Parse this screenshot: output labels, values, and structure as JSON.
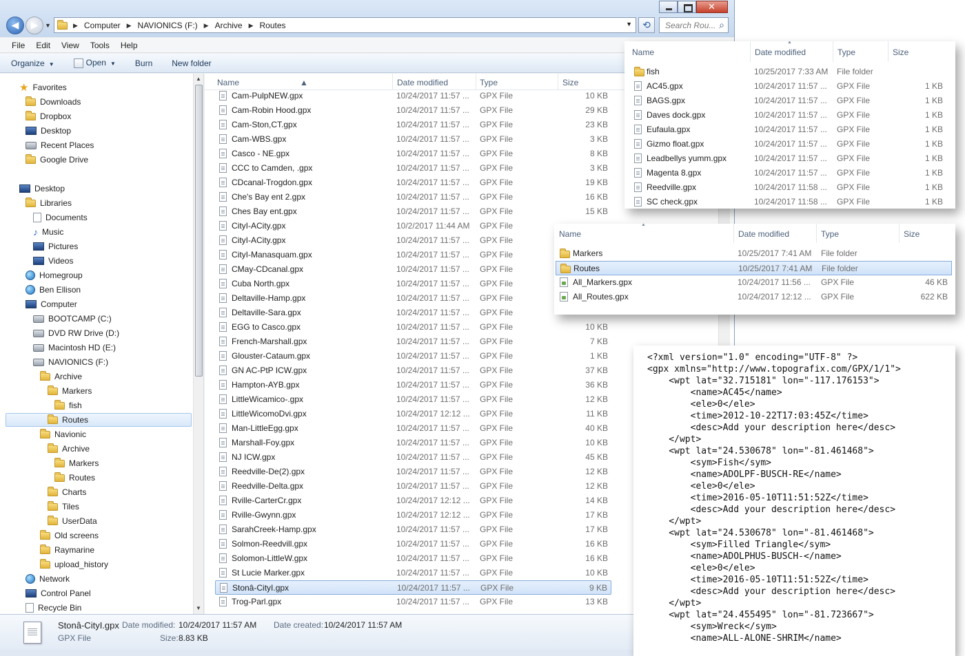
{
  "window": {
    "address": [
      "Computer",
      "NAVIONICS (F:)",
      "Archive",
      "Routes"
    ],
    "search_placeholder": "Search Rou..."
  },
  "menu": [
    "File",
    "Edit",
    "View",
    "Tools",
    "Help"
  ],
  "commands": {
    "organize": "Organize",
    "open": "Open",
    "burn": "Burn",
    "new_folder": "New folder"
  },
  "nav": [
    {
      "label": "Favorites",
      "icon": "star-icon",
      "indent": 0
    },
    {
      "label": "Downloads",
      "icon": "folder-icon",
      "indent": 1
    },
    {
      "label": "Dropbox",
      "icon": "folder-icon",
      "indent": 1
    },
    {
      "label": "Desktop",
      "icon": "desktop-icon",
      "indent": 1
    },
    {
      "label": "Recent Places",
      "icon": "recent-places-icon",
      "indent": 1
    },
    {
      "label": "Google Drive",
      "icon": "folder-icon",
      "indent": 1
    },
    {
      "label": "",
      "icon": "",
      "indent": 0
    },
    {
      "label": "Desktop",
      "icon": "desktop-icon",
      "indent": 0
    },
    {
      "label": "Libraries",
      "icon": "folder-icon",
      "indent": 1
    },
    {
      "label": "Documents",
      "icon": "document-icon",
      "indent": 2
    },
    {
      "label": "Music",
      "icon": "music-icon",
      "indent": 2
    },
    {
      "label": "Pictures",
      "icon": "pictures-icon",
      "indent": 2
    },
    {
      "label": "Videos",
      "icon": "videos-icon",
      "indent": 2
    },
    {
      "label": "Homegroup",
      "icon": "globe-icon",
      "indent": 1
    },
    {
      "label": "Ben Ellison",
      "icon": "user-icon",
      "indent": 1
    },
    {
      "label": "Computer",
      "icon": "computer-icon",
      "indent": 1
    },
    {
      "label": "BOOTCAMP (C:)",
      "icon": "drive-icon",
      "indent": 2
    },
    {
      "label": "DVD RW Drive (D:)",
      "icon": "dvd-icon",
      "indent": 2
    },
    {
      "label": "Macintosh HD (E:)",
      "icon": "drive-icon",
      "indent": 2
    },
    {
      "label": "NAVIONICS (F:)",
      "icon": "drive-icon",
      "indent": 2
    },
    {
      "label": "Archive",
      "icon": "folder-icon",
      "indent": 3
    },
    {
      "label": "Markers",
      "icon": "folder-icon",
      "indent": 4
    },
    {
      "label": "fish",
      "icon": "folder-icon",
      "indent": 5
    },
    {
      "label": "Routes",
      "icon": "folder-icon",
      "indent": 4
    },
    {
      "label": "Navionic",
      "icon": "folder-icon",
      "indent": 3
    },
    {
      "label": "Archive",
      "icon": "folder-icon",
      "indent": 4
    },
    {
      "label": "Markers",
      "icon": "folder-icon",
      "indent": 5
    },
    {
      "label": "Routes",
      "icon": "folder-icon",
      "indent": 5
    },
    {
      "label": "Charts",
      "icon": "folder-icon",
      "indent": 4
    },
    {
      "label": "Tiles",
      "icon": "folder-icon",
      "indent": 4
    },
    {
      "label": "UserData",
      "icon": "folder-icon",
      "indent": 4
    },
    {
      "label": "Old screens",
      "icon": "folder-icon",
      "indent": 3
    },
    {
      "label": "Raymarine",
      "icon": "folder-icon",
      "indent": 3
    },
    {
      "label": "upload_history",
      "icon": "folder-icon",
      "indent": 3
    },
    {
      "label": "Network",
      "icon": "globe-icon",
      "indent": 1
    },
    {
      "label": "Control Panel",
      "icon": "control-panel-icon",
      "indent": 1
    },
    {
      "label": "Recycle Bin",
      "icon": "recycle-bin-icon",
      "indent": 1
    }
  ],
  "nav_selected_index": 23,
  "list": {
    "headers": {
      "name": "Name",
      "date": "Date modified",
      "type": "Type",
      "size": "Size"
    },
    "files": [
      [
        "Cam-PulpNEW.gpx",
        "10/24/2017 11:57 ...",
        "GPX File",
        "10 KB"
      ],
      [
        "Cam-Robin Hood.gpx",
        "10/24/2017 11:57 ...",
        "GPX File",
        "29 KB"
      ],
      [
        "Cam-Ston,CT.gpx",
        "10/24/2017 11:57 ...",
        "GPX File",
        "23 KB"
      ],
      [
        "Cam-WBS.gpx",
        "10/24/2017 11:57 ...",
        "GPX File",
        "3 KB"
      ],
      [
        "Casco - NE.gpx",
        "10/24/2017 11:57 ...",
        "GPX File",
        "8 KB"
      ],
      [
        "CCC to Camden, .gpx",
        "10/24/2017 11:57 ...",
        "GPX File",
        "3 KB"
      ],
      [
        "CDcanal-Trogdon.gpx",
        "10/24/2017 11:57 ...",
        "GPX File",
        "19 KB"
      ],
      [
        "Che's Bay ent 2.gpx",
        "10/24/2017 11:57 ...",
        "GPX File",
        "16 KB"
      ],
      [
        "Ches Bay ent.gpx",
        "10/24/2017 11:57 ...",
        "GPX File",
        "15 KB"
      ],
      [
        "CityI-ACity.gpx",
        "10/2/2017 11:44 AM",
        "GPX File",
        ""
      ],
      [
        "CityI-ACity.gpx",
        "10/24/2017 11:57 ...",
        "GPX File",
        ""
      ],
      [
        "CityI-Manasquam.gpx",
        "10/24/2017 11:57 ...",
        "GPX File",
        ""
      ],
      [
        "CMay-CDcanal.gpx",
        "10/24/2017 11:57 ...",
        "GPX File",
        ""
      ],
      [
        "Cuba North.gpx",
        "10/24/2017 11:57 ...",
        "GPX File",
        ""
      ],
      [
        "Deltaville-Hamp.gpx",
        "10/24/2017 11:57 ...",
        "GPX File",
        ""
      ],
      [
        "Deltaville-Sara.gpx",
        "10/24/2017 11:57 ...",
        "GPX File",
        ""
      ],
      [
        "EGG to Casco.gpx",
        "10/24/2017 11:57 ...",
        "GPX File",
        "10 KB"
      ],
      [
        "French-Marshall.gpx",
        "10/24/2017 11:57 ...",
        "GPX File",
        "7 KB"
      ],
      [
        "Glouster-Cataum.gpx",
        "10/24/2017 11:57 ...",
        "GPX File",
        "1 KB"
      ],
      [
        "GN AC-PtP ICW.gpx",
        "10/24/2017 11:57 ...",
        "GPX File",
        "37 KB"
      ],
      [
        "Hampton-AYB.gpx",
        "10/24/2017 11:57 ...",
        "GPX File",
        "36 KB"
      ],
      [
        "LittleWicamico-.gpx",
        "10/24/2017 11:57 ...",
        "GPX File",
        "12 KB"
      ],
      [
        "LittleWicomoDvi.gpx",
        "10/24/2017 12:12 ...",
        "GPX File",
        "11 KB"
      ],
      [
        "Man-LittleEgg.gpx",
        "10/24/2017 11:57 ...",
        "GPX File",
        "40 KB"
      ],
      [
        "Marshall-Foy.gpx",
        "10/24/2017 11:57 ...",
        "GPX File",
        "10 KB"
      ],
      [
        "NJ ICW.gpx",
        "10/24/2017 11:57 ...",
        "GPX File",
        "45 KB"
      ],
      [
        "Reedville-De(2).gpx",
        "10/24/2017 11:57 ...",
        "GPX File",
        "12 KB"
      ],
      [
        "Reedville-Delta.gpx",
        "10/24/2017 11:57 ...",
        "GPX File",
        "12 KB"
      ],
      [
        "Rville-CarterCr.gpx",
        "10/24/2017 12:12 ...",
        "GPX File",
        "14 KB"
      ],
      [
        "Rville-Gwynn.gpx",
        "10/24/2017 12:12 ...",
        "GPX File",
        "17 KB"
      ],
      [
        "SarahCreek-Hamp.gpx",
        "10/24/2017 11:57 ...",
        "GPX File",
        "17 KB"
      ],
      [
        "Solmon-Reedvill.gpx",
        "10/24/2017 11:57 ...",
        "GPX File",
        "16 KB"
      ],
      [
        "Solomon-LittleW.gpx",
        "10/24/2017 11:57 ...",
        "GPX File",
        "16 KB"
      ],
      [
        "St Lucie Marker.gpx",
        "10/24/2017 11:57 ...",
        "GPX File",
        "10 KB"
      ],
      [
        "Stonâ-CityI.gpx",
        "10/24/2017 11:57 ...",
        "GPX File",
        "9 KB"
      ],
      [
        "Trog-Parl.gpx",
        "10/24/2017 11:57 ...",
        "GPX File",
        "13 KB"
      ]
    ],
    "selected_index": 34
  },
  "details": {
    "name": "Stonâ-CityI.gpx",
    "type": "GPX File",
    "date_modified_label": "Date modified:",
    "date_modified": "10/24/2017 11:57 AM",
    "date_created_label": "Date created:",
    "date_created": "10/24/2017 11:57 AM",
    "size_label": "Size:",
    "size": "8.83 KB"
  },
  "panel_markers": {
    "headers": {
      "name": "Name",
      "date": "Date modified",
      "type": "Type",
      "size": "Size"
    },
    "rows": [
      [
        "fish",
        "10/25/2017 7:33 AM",
        "File folder",
        "",
        "folder"
      ],
      [
        "AC45.gpx",
        "10/24/2017 11:57 ...",
        "GPX File",
        "1 KB",
        "file"
      ],
      [
        "BAGS.gpx",
        "10/24/2017 11:57 ...",
        "GPX File",
        "1 KB",
        "file"
      ],
      [
        "Daves dock.gpx",
        "10/24/2017 11:57 ...",
        "GPX File",
        "1 KB",
        "file"
      ],
      [
        "Eufaula.gpx",
        "10/24/2017 11:57 ...",
        "GPX File",
        "1 KB",
        "file"
      ],
      [
        "Gizmo float.gpx",
        "10/24/2017 11:57 ...",
        "GPX File",
        "1 KB",
        "file"
      ],
      [
        "Leadbellys yumm.gpx",
        "10/24/2017 11:57 ...",
        "GPX File",
        "1 KB",
        "file"
      ],
      [
        "Magenta 8.gpx",
        "10/24/2017 11:57 ...",
        "GPX File",
        "1 KB",
        "file"
      ],
      [
        "Reedville.gpx",
        "10/24/2017 11:58 ...",
        "GPX File",
        "1 KB",
        "file"
      ],
      [
        "SC check.gpx",
        "10/24/2017 11:58 ...",
        "GPX File",
        "1 KB",
        "file"
      ]
    ]
  },
  "panel_archive": {
    "headers": {
      "name": "Name",
      "date": "Date modified",
      "type": "Type",
      "size": "Size"
    },
    "rows": [
      [
        "Markers",
        "10/25/2017 7:41 AM",
        "File folder",
        "",
        "folder"
      ],
      [
        "Routes",
        "10/25/2017 7:41 AM",
        "File folder",
        "",
        "folder"
      ],
      [
        "All_Markers.gpx",
        "10/24/2017 11:56 ...",
        "GPX File",
        "46 KB",
        "gpx"
      ],
      [
        "All_Routes.gpx",
        "10/24/2017 12:12 ...",
        "GPX File",
        "622 KB",
        "gpx"
      ]
    ],
    "selected_index": 1
  },
  "xml_lines": [
    "<?xml version=\"1.0\" encoding=\"UTF-8\" ?>",
    "<gpx xmlns=\"http://www.topografix.com/GPX/1/1\">",
    "    <wpt lat=\"32.715181\" lon=\"-117.176153\">",
    "        <name>AC45</name>",
    "        <ele>0</ele>",
    "        <time>2012-10-22T17:03:45Z</time>",
    "        <desc>Add your description here</desc>",
    "    </wpt>",
    "    <wpt lat=\"24.530678\" lon=\"-81.461468\">",
    "        <sym>Fish</sym>",
    "        <name>ADOLPF-BUSCH-RE</name>",
    "        <ele>0</ele>",
    "        <time>2016-05-10T11:51:52Z</time>",
    "        <desc>Add your description here</desc>",
    "    </wpt>",
    "    <wpt lat=\"24.530678\" lon=\"-81.461468\">",
    "        <sym>Filled Triangle</sym>",
    "        <name>ADOLPHUS-BUSCH-</name>",
    "        <ele>0</ele>",
    "        <time>2016-05-10T11:51:52Z</time>",
    "        <desc>Add your description here</desc>",
    "    </wpt>",
    "    <wpt lat=\"24.455495\" lon=\"-81.723667\">",
    "        <sym>Wreck</sym>",
    "        <name>ALL-ALONE-SHRIM</name>"
  ]
}
